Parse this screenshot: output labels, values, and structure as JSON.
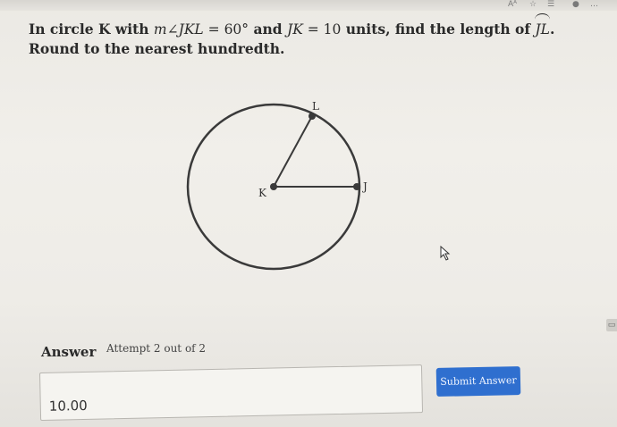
{
  "question": {
    "intro": "In circle K with ",
    "angle_m": "m",
    "angle_symbol": "∠",
    "angle_name": "JKL",
    "angle_eq": " = ",
    "angle_value": "60°",
    "and_text": " and ",
    "segment_name": "JK",
    "segment_eq": " = ",
    "segment_value": "10",
    "find_text": " units, find the length of ",
    "arc_name": "JL",
    "round_text": ". Round to the nearest hundredth."
  },
  "diagram": {
    "center_label": "K",
    "point_l_label": "L",
    "point_j_label": "J",
    "angle_degrees": 60
  },
  "answer": {
    "label": "Answer",
    "attempt_text": "Attempt 2 out of 2",
    "input_value": "10.00",
    "submit_label": "Submit Answer"
  },
  "colors": {
    "submit_bg": "#2f6fcf",
    "circle_stroke": "#3a3a3a"
  },
  "icons": {
    "cursor": "pointer-cursor-icon",
    "side_tab": "calculator-tab-icon"
  }
}
